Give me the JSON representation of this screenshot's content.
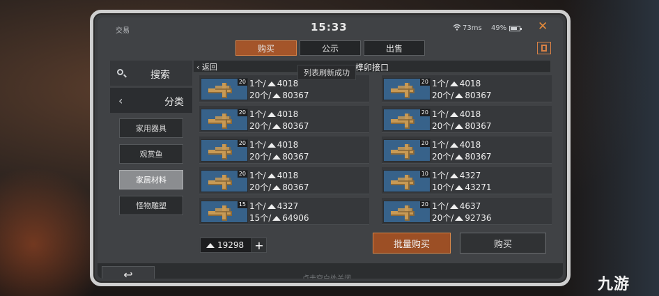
{
  "status_bar": {
    "app_name": "交易",
    "time": "15:33",
    "ping": "73ms",
    "battery": "49%"
  },
  "tabs": [
    {
      "label": "购买",
      "active": true
    },
    {
      "label": "公示",
      "active": false
    },
    {
      "label": "出售",
      "active": false
    }
  ],
  "sidebar": {
    "search_label": "搜索",
    "category_label": "分类",
    "items": [
      {
        "label": "家用器具",
        "active": false
      },
      {
        "label": "观赏鱼",
        "active": false
      },
      {
        "label": "家居材料",
        "active": true
      },
      {
        "label": "怪物雕塑",
        "active": false
      }
    ]
  },
  "content": {
    "back_label": "返回",
    "title": "榫卯接口",
    "toast": "列表刷新成功",
    "listings": [
      {
        "qty": "20",
        "unit_line": "1个/",
        "unit_price": "4018",
        "total_line": "20个/",
        "total_price": "80367"
      },
      {
        "qty": "20",
        "unit_line": "1个/",
        "unit_price": "4018",
        "total_line": "20个/",
        "total_price": "80367"
      },
      {
        "qty": "20",
        "unit_line": "1个/",
        "unit_price": "4018",
        "total_line": "20个/",
        "total_price": "80367"
      },
      {
        "qty": "20",
        "unit_line": "1个/",
        "unit_price": "4018",
        "total_line": "20个/",
        "total_price": "80367"
      },
      {
        "qty": "20",
        "unit_line": "1个/",
        "unit_price": "4018",
        "total_line": "20个/",
        "total_price": "80367"
      },
      {
        "qty": "20",
        "unit_line": "1个/",
        "unit_price": "4018",
        "total_line": "20个/",
        "total_price": "80367"
      },
      {
        "qty": "20",
        "unit_line": "1个/",
        "unit_price": "4018",
        "total_line": "20个/",
        "total_price": "80367"
      },
      {
        "qty": "10",
        "unit_line": "1个/",
        "unit_price": "4327",
        "total_line": "10个/",
        "total_price": "43271"
      },
      {
        "qty": "15",
        "unit_line": "1个/",
        "unit_price": "4327",
        "total_line": "15个/",
        "total_price": "64906"
      },
      {
        "qty": "20",
        "unit_line": "1个/",
        "unit_price": "4637",
        "total_line": "20个/",
        "total_price": "92736"
      }
    ]
  },
  "footer": {
    "wallet_amount": "19298",
    "add_label": "+",
    "bulk_buy_label": "批量购买",
    "buy_label": "购买",
    "close_hint": "点击空白处关闭",
    "return_icon": "↩"
  },
  "icons": {
    "close": "✕",
    "chevron_left": "‹",
    "back": "‹",
    "coin": "coin-icon",
    "search": "search-icon"
  },
  "watermark": "九游",
  "colors": {
    "accent": "#a4552a",
    "accent_border": "#d98145",
    "panel": "#404245"
  }
}
